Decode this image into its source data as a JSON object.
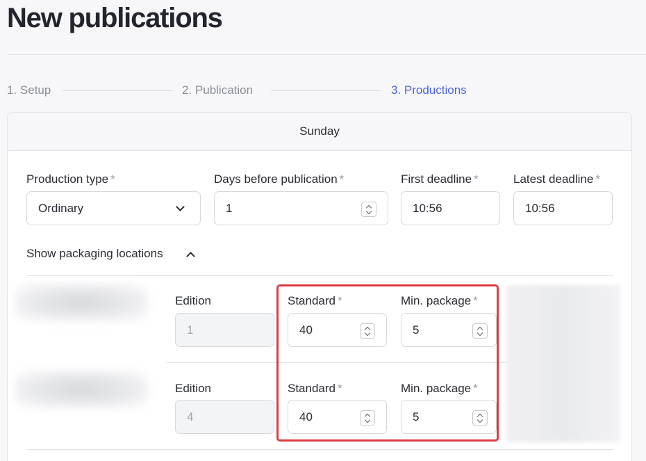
{
  "page": {
    "title": "New publications"
  },
  "steps": [
    {
      "label": "1. Setup",
      "state": "done"
    },
    {
      "label": "2. Publication",
      "state": "done"
    },
    {
      "label": "3. Productions",
      "state": "active"
    }
  ],
  "colors": {
    "accent": "#4f63e0",
    "highlight": "#dc3c43"
  },
  "card": {
    "day": "Sunday",
    "production_type": {
      "label": "Production type",
      "required": "*",
      "value": "Ordinary"
    },
    "days_before": {
      "label": "Days before publication",
      "required": "*",
      "value": "1"
    },
    "first_deadline": {
      "label": "First deadline",
      "required": "*",
      "value": "10:56"
    },
    "latest_deadline": {
      "label": "Latest deadline",
      "required": "*",
      "value": "10:56"
    },
    "packaging_toggle": "Show packaging locations",
    "rows": [
      {
        "edition_label": "Edition",
        "edition_value": "1",
        "standard_label": "Standard",
        "standard_value": "40",
        "min_label": "Min. package",
        "min_value": "5",
        "required": "*"
      },
      {
        "edition_label": "Edition",
        "edition_value": "4",
        "standard_label": "Standard",
        "standard_value": "40",
        "min_label": "Min. package",
        "min_value": "5",
        "required": "*"
      }
    ]
  }
}
